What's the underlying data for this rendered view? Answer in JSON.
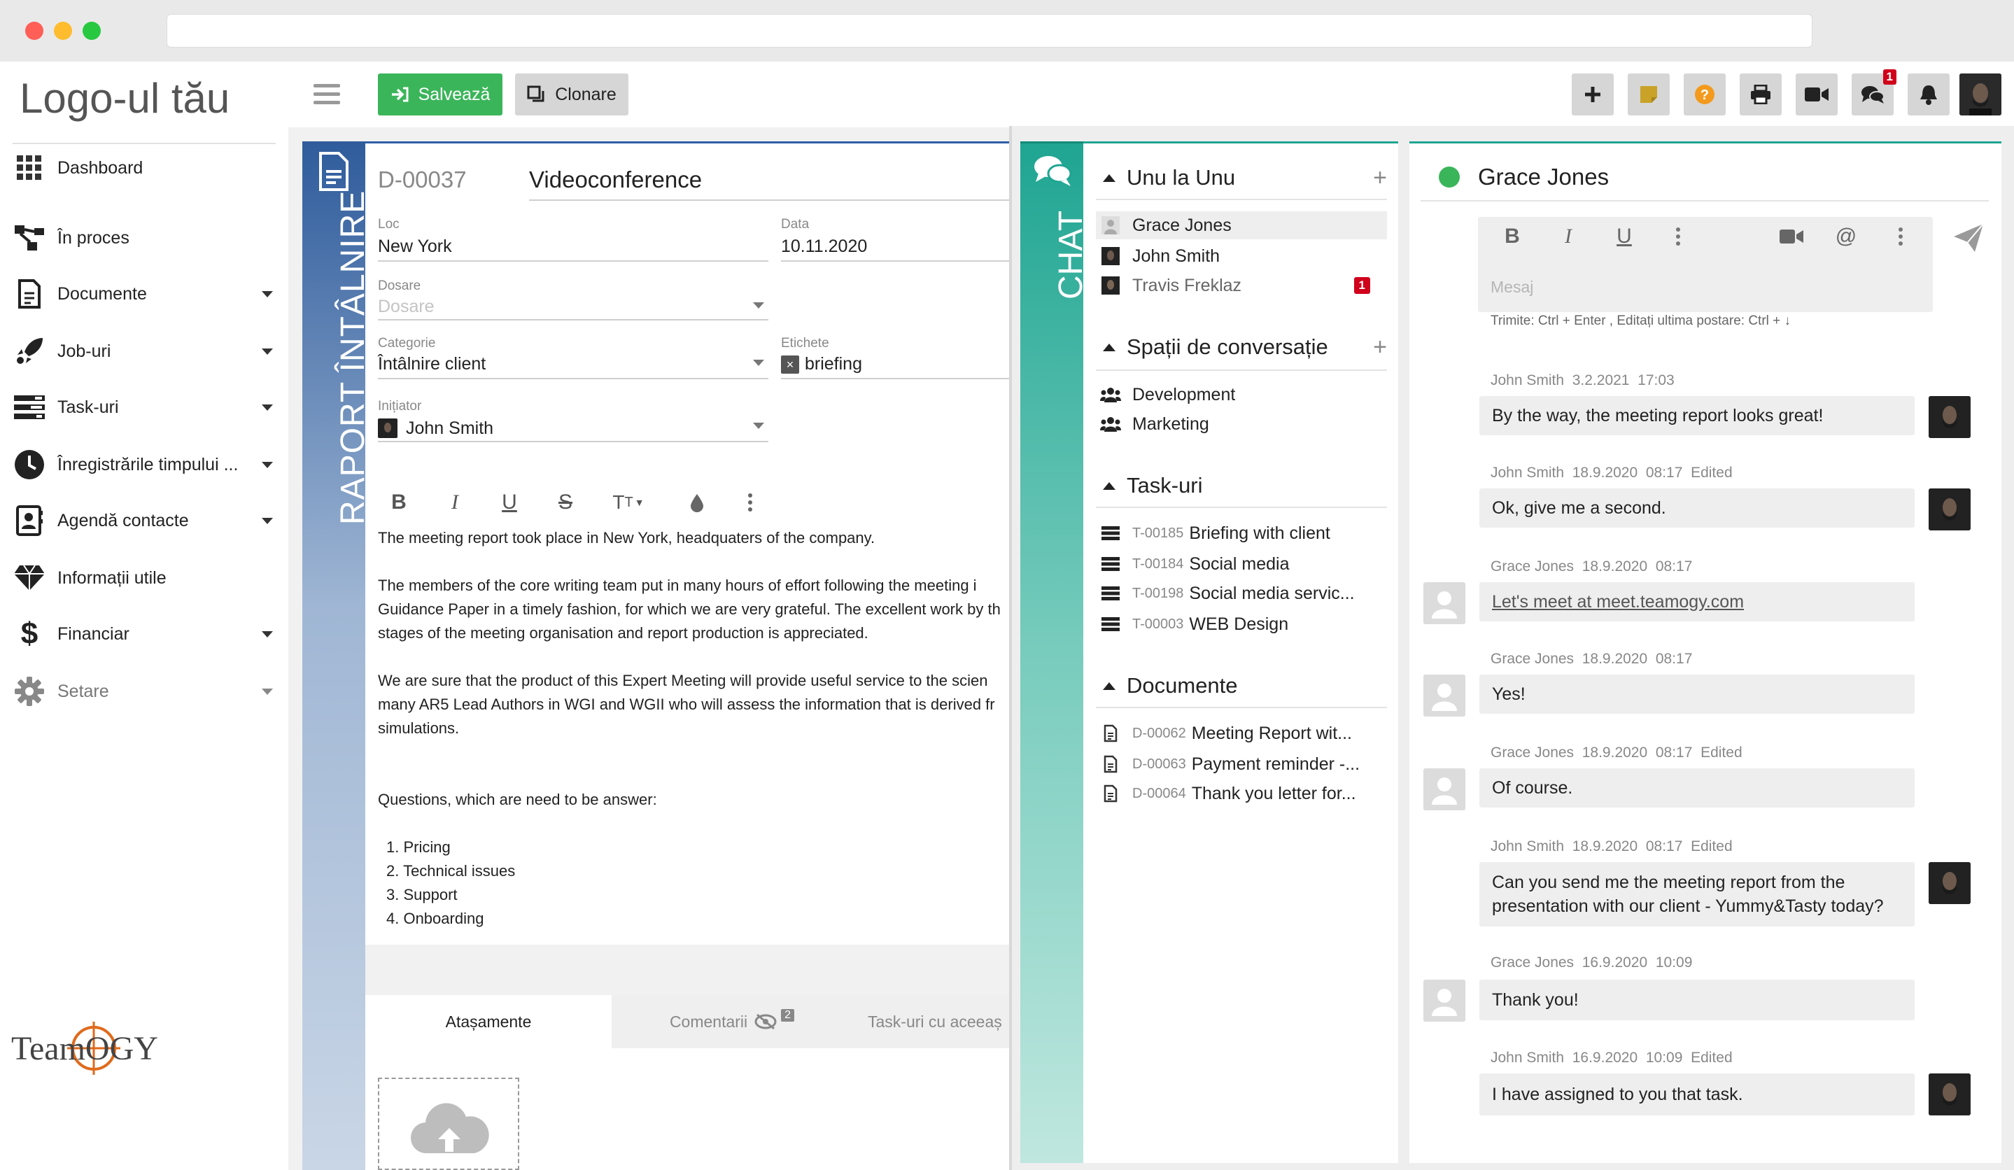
{
  "app": {
    "logo_text": "Logo-ul tău",
    "brand_logo": "TeamOGY"
  },
  "sidebar": {
    "items": [
      {
        "label": "Dashboard",
        "icon": "grid-icon",
        "has_submenu": false
      },
      {
        "label": "În proces",
        "icon": "workflow-icon",
        "has_submenu": false
      },
      {
        "label": "Documente",
        "icon": "document-icon",
        "has_submenu": true
      },
      {
        "label": "Job-uri",
        "icon": "rocket-icon",
        "has_submenu": true
      },
      {
        "label": "Task-uri",
        "icon": "tasks-icon",
        "has_submenu": true
      },
      {
        "label": "Înregistrările timpului ...",
        "icon": "clock-icon",
        "has_submenu": true
      },
      {
        "label": "Agendă contacte",
        "icon": "contacts-icon",
        "has_submenu": true
      },
      {
        "label": "Informații utile",
        "icon": "diamond-icon",
        "has_submenu": false
      },
      {
        "label": "Financiar",
        "icon": "dollar-icon",
        "has_submenu": true
      },
      {
        "label": "Setare",
        "icon": "gear-icon",
        "has_submenu": true
      }
    ]
  },
  "toolbar": {
    "save_label": "Salvează",
    "clone_label": "Clonare",
    "chat_badge": "1",
    "icons": [
      "plus-icon",
      "note-icon",
      "help-icon",
      "print-icon",
      "video-icon",
      "chat-icon",
      "bell-icon"
    ]
  },
  "document": {
    "strip_title": "RAPORT ÎNTÂLNIRE",
    "number": "D-00037",
    "title": "Videoconference",
    "fields": {
      "loc_label": "Loc",
      "loc_value": "New York",
      "data_label": "Data",
      "data_value": "10.11.2020",
      "dosare_label": "Dosare",
      "dosare_placeholder": "Dosare",
      "categorie_label": "Categorie",
      "categorie_value": "Întâlnire client",
      "etichete_label": "Etichete",
      "etichete_value": "briefing",
      "initiator_label": "Inițiator",
      "initiator_value": "John Smith"
    },
    "body": {
      "p1": "The meeting report took place in New York, headquaters of the company.",
      "p2_l1": " The members of the core writing team put in many hours of effort following the meeting i",
      "p2_l2": "Guidance Paper in a timely fashion, for which we are very grateful. The excellent work by th",
      "p2_l3": "stages of the meeting organisation and report production is appreciated.",
      "p3_l1": "We are sure that the product of this Expert Meeting will provide useful service to the scien",
      "p3_l2": "many AR5 Lead Authors in WGI and WGII who will assess the information that is derived fr",
      "p3_l3": "simulations.",
      "p4": "Questions, which are need to be answer:",
      "list": [
        "1. Pricing",
        "2. Technical issues",
        "3. Support",
        "4. Onboarding"
      ]
    },
    "tabs": {
      "attachments": "Atașamente",
      "comments": "Comentarii",
      "comments_badge": "2",
      "related_tasks": "Task-uri cu aceeaș"
    }
  },
  "chat": {
    "strip_title": "CHAT",
    "sections": {
      "direct": "Unu la Unu",
      "spaces": "Spații de conversație",
      "tasks": "Task-uri",
      "documents": "Documente"
    },
    "direct": [
      {
        "name": "Grace Jones",
        "selected": true,
        "badge": ""
      },
      {
        "name": "John Smith",
        "selected": false,
        "badge": ""
      },
      {
        "name": "Travis Freklaz",
        "selected": false,
        "badge": "1"
      }
    ],
    "spaces": [
      "Development",
      "Marketing"
    ],
    "tasks": [
      {
        "code": "T-00185",
        "name": "Briefing with client"
      },
      {
        "code": "T-00184",
        "name": "Social media"
      },
      {
        "code": "T-00198",
        "name": "Social media servic..."
      },
      {
        "code": "T-00003",
        "name": "WEB Design"
      }
    ],
    "documents": [
      {
        "code": "D-00062",
        "name": "Meeting Report wit..."
      },
      {
        "code": "D-00063",
        "name": "Payment reminder -..."
      },
      {
        "code": "D-00064",
        "name": "Thank you letter for..."
      }
    ],
    "conversation": {
      "contact": "Grace Jones",
      "status_color": "#3bb55a",
      "input_placeholder": "Mesaj",
      "hint": "Trimite: Ctrl + Enter , Editați ultima postare: Ctrl + ↓",
      "messages": [
        {
          "author": "John Smith",
          "date": "3.2.2021",
          "time": "17:03",
          "edited": "",
          "text": "By the way, the meeting report looks great!",
          "mine": true
        },
        {
          "author": "John Smith",
          "date": "18.9.2020",
          "time": "08:17",
          "edited": "Edited",
          "text": "Ok, give me a second.",
          "mine": true
        },
        {
          "author": "Grace Jones",
          "date": "18.9.2020",
          "time": "08:17",
          "edited": "",
          "text": "Let's meet at meet.teamogy.com",
          "mine": false
        },
        {
          "author": "Grace Jones",
          "date": "18.9.2020",
          "time": "08:17",
          "edited": "",
          "text": "Yes!",
          "mine": false
        },
        {
          "author": "Grace Jones",
          "date": "18.9.2020",
          "time": "08:17",
          "edited": "Edited",
          "text": "Of course.",
          "mine": false
        },
        {
          "author": "John Smith",
          "date": "18.9.2020",
          "time": "08:17",
          "edited": "Edited",
          "text_l1": "Can you send me the meeting report from the",
          "text_l2": "presentation with our client - Yummy&Tasty today?",
          "mine": true
        },
        {
          "author": "Grace Jones",
          "date": "16.9.2020",
          "time": "10:09",
          "edited": "",
          "text": "Thank you!",
          "mine": false
        },
        {
          "author": "John Smith",
          "date": "16.9.2020",
          "time": "10:09",
          "edited": "Edited",
          "text": "I have assigned to you that task.",
          "mine": true
        }
      ]
    }
  },
  "colors": {
    "save_green": "#3bb55a",
    "doc_blue": "#2f5c9c",
    "chat_teal": "#1fa592",
    "badge_red": "#d0021b"
  }
}
